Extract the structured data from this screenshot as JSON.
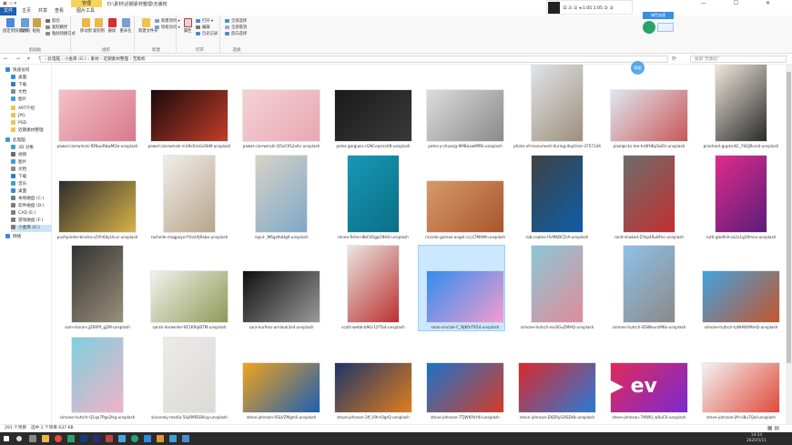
{
  "window": {
    "title": "D:\\素材\\近期素材整理\\无版权",
    "quick_access": "▣ ▭ ▾",
    "contextual_tab": "管理",
    "controls": "— ☐ ✕"
  },
  "ribbon_tabs": [
    "文件",
    "主页",
    "共享",
    "查看",
    "图片工具"
  ],
  "ribbon": {
    "groups": [
      {
        "label": "剪贴板",
        "buttons": [
          "固定到快速访问",
          "复制",
          "粘贴"
        ],
        "small": [
          "剪切",
          "复制路径",
          "粘贴快捷方式"
        ]
      },
      {
        "label": "组织",
        "buttons": [
          "移动到",
          "复制到",
          "删除",
          "重命名"
        ]
      },
      {
        "label": "新建",
        "buttons": [
          "新建文件夹"
        ],
        "small": [
          "新建项目 ▾",
          "轻松访问 ▾"
        ]
      },
      {
        "label": "打开",
        "buttons": [
          "属性"
        ],
        "small": [
          "打开 ▾",
          "编辑",
          "历史记录"
        ]
      },
      {
        "label": "选择",
        "small": [
          "全部选择",
          "全部取消",
          "反向选择"
        ]
      }
    ]
  },
  "overlay": {
    "text": "D  斗 斗 ◂ 1:05 1:05 斗 斗"
  },
  "widget": {
    "badge": "绿色加速"
  },
  "address": {
    "nav": "← → ▾ ↑",
    "path": "› 此电脑 › 小金库 (G:) › 素材 › 近期素材整理 › 无版权",
    "search_placeholder": "搜索\"无版权\""
  },
  "sidebar": {
    "items": [
      {
        "label": "快速访问",
        "icon": "star-icon",
        "color": "#3a87d6"
      },
      {
        "label": "桌面",
        "icon": "desktop-icon",
        "color": "#3b8ad6",
        "pinned": true
      },
      {
        "label": "下载",
        "icon": "download-icon",
        "color": "#2e7cd0",
        "pinned": true
      },
      {
        "label": "文档",
        "icon": "document-icon",
        "color": "#8a8a8a",
        "pinned": true
      },
      {
        "label": "图片",
        "icon": "picture-icon",
        "color": "#3aa0d8",
        "pinned": true
      },
      {
        "label": "ART介绍",
        "icon": "folder-icon",
        "color": "#f0c44c"
      },
      {
        "label": "JPG",
        "icon": "folder-icon",
        "color": "#f0c44c"
      },
      {
        "label": "PSD",
        "icon": "folder-icon",
        "color": "#f0c44c"
      },
      {
        "label": "近期素材整理",
        "icon": "folder-icon",
        "color": "#f0c44c"
      },
      {
        "label": "此电脑",
        "icon": "computer-icon",
        "color": "#4a90d9"
      },
      {
        "label": "3D 对象",
        "icon": "cube-icon",
        "color": "#3aa0d8"
      },
      {
        "label": "视频",
        "icon": "video-icon",
        "color": "#6a6a6a"
      },
      {
        "label": "图片",
        "icon": "picture-icon",
        "color": "#3aa0d8"
      },
      {
        "label": "文档",
        "icon": "document-icon",
        "color": "#8a8a8a"
      },
      {
        "label": "下载",
        "icon": "download-icon",
        "color": "#2e7cd0"
      },
      {
        "label": "音乐",
        "icon": "music-icon",
        "color": "#3aa0d8"
      },
      {
        "label": "桌面",
        "icon": "desktop-icon",
        "color": "#3b8ad6"
      },
      {
        "label": "本地磁盘 (C:)",
        "icon": "drive-icon",
        "color": "#7a7a7a"
      },
      {
        "label": "软件磁盘 (D:)",
        "icon": "drive-icon",
        "color": "#7a7a7a"
      },
      {
        "label": "CAD (E:)",
        "icon": "drive-icon",
        "color": "#7a7a7a"
      },
      {
        "label": "游戏磁盘 (F:)",
        "icon": "drive-icon",
        "color": "#7a7a7a"
      },
      {
        "label": "小金库 (G:)",
        "icon": "drive-icon",
        "color": "#7a7a7a",
        "selected": true
      },
      {
        "label": "网络",
        "icon": "network-icon",
        "color": "#3a87d6"
      }
    ]
  },
  "files": [
    {
      "name": "pawel-czerwinski-fDNuoRbwMOo-unsplash",
      "colors": [
        "#f3c1c8",
        "#d9798c"
      ],
      "orient": "land"
    },
    {
      "name": "pawel-czerwinski-m39e5mGsXbM-unsplash",
      "colors": [
        "#1b0b0b",
        "#c33d2a"
      ],
      "orient": "land"
    },
    {
      "name": "pawel-czerwinski-Q5oCtfL2xKc-unsplash",
      "colors": [
        "#f4d2d6",
        "#e9a7b2"
      ],
      "orient": "land"
    },
    {
      "name": "peter-gargiulo-cGNCepznaV8-unsplash",
      "colors": [
        "#1a1a1a",
        "#3a3a3a"
      ],
      "orient": "land"
    },
    {
      "name": "peter-y-chuang-9MBaxwMfRk-unsplash",
      "colors": [
        "#dcdcdc",
        "#8a8a8a"
      ],
      "orient": "land"
    },
    {
      "name": "photo-of-monument-during-daytime-3757144",
      "colors": [
        "#e0e4ea",
        "#9e8f7a"
      ],
      "orient": "port"
    },
    {
      "name": "pixelpicks-lee-hs0fHKpSxEU-unsplash",
      "colors": [
        "#dfe7f1",
        "#c95858"
      ],
      "orient": "land"
    },
    {
      "name": "prashant-gupta-KC_YSQJfkcn4-unsplash",
      "colors": [
        "#efe7dc",
        "#2a2a2a"
      ],
      "orient": "port"
    },
    {
      "name": "pushpinder-bindra-u5Yh6dyUcuc-unsplash",
      "colors": [
        "#2d2d2d",
        "#d8b24a"
      ],
      "orient": "land"
    },
    {
      "name": "rachelle-magpayo-YVvUAJ0abo-unsplash",
      "colors": [
        "#f0eeea",
        "#b8a48a"
      ],
      "orient": "port"
    },
    {
      "name": "rayul-_M6gz9oHgII-unsplash",
      "colors": [
        "#d8d2c5",
        "#7fa8c9"
      ],
      "orient": "port"
    },
    {
      "name": "renee-fisher-8bCkRgpCNHU-unsplash",
      "colors": [
        "#1798b5",
        "#0a6f85"
      ],
      "orient": "port"
    },
    {
      "name": "ricardo-gomez-angel-ccj-LTMAMI-unsplash",
      "colors": [
        "#d69a6b",
        "#a9552c"
      ],
      "orient": "land"
    },
    {
      "name": "rob-coates-l5rMKBCZrA-unsplash",
      "colors": [
        "#3e4243",
        "#0e5da7"
      ],
      "orient": "port"
    },
    {
      "name": "ronit-shaked-ZYkp4Ru8Fec-unsplash",
      "colors": [
        "#6d6d6d",
        "#c32f2f"
      ],
      "orient": "port"
    },
    {
      "name": "ruth-gledhill-za2x1g19mco-unsplash",
      "colors": [
        "#e02c8a",
        "#5a1c7a"
      ],
      "orient": "port"
    },
    {
      "name": "sam-moran-jjZ6RPt_gZM-unsplash",
      "colors": [
        "#333333",
        "#9a8f7a"
      ],
      "orient": "port"
    },
    {
      "name": "sarah-dorweiler-9Z1KRIpBTM-unsplash",
      "colors": [
        "#f2f2ee",
        "#8f9a56"
      ],
      "orient": "land"
    },
    {
      "name": "sara-kurfess-urnIauk3x4-unsplash",
      "colors": [
        "#101010",
        "#9a9a9a"
      ],
      "orient": "land"
    },
    {
      "name": "scott-webb-b9Gr1jYTb4-unsplash",
      "colors": [
        "#eae6e0",
        "#b93030"
      ],
      "orient": "port"
    },
    {
      "name": "sean-sinclair-C_NJKfnTR54-unsplash",
      "colors": [
        "#2f8ef0",
        "#f39cd0"
      ],
      "orient": "land",
      "selected": true
    },
    {
      "name": "simone-hutsch-eo3IGuZMHQ-unsplash",
      "colors": [
        "#8ac7d6",
        "#e08c9a"
      ],
      "orient": "port"
    },
    {
      "name": "simone-hutsch-lDSNeursM6o-unsplash",
      "colors": [
        "#8ec1e8",
        "#8a8a8a"
      ],
      "orient": "port"
    },
    {
      "name": "simone-hutsch-lyNHWXMmQ-unsplash",
      "colors": [
        "#3fa3de",
        "#c5552c"
      ],
      "orient": "land"
    },
    {
      "name": "simone-hutsch-Q1qo7Pgx2Hg-unsplash",
      "colors": [
        "#7ed0df",
        "#f0b2c6"
      ],
      "orient": "port"
    },
    {
      "name": "sincerely-media-5kjAMREBAcg-unsplash",
      "colors": [
        "#ecebe8",
        "#dcdad5"
      ],
      "orient": "port"
    },
    {
      "name": "steve-johnson-0SLVZMgmli-unsplash",
      "colors": [
        "#f0a31c",
        "#1c5fb4"
      ],
      "orient": "land"
    },
    {
      "name": "steve-johnson-3lf_U9nrOgrQ-unsplash",
      "colors": [
        "#1d3568",
        "#e07d1c"
      ],
      "orient": "land"
    },
    {
      "name": "steve-johnson-7TJWKPoYdI-unsplash",
      "colors": [
        "#1a74c8",
        "#d43c2a"
      ],
      "orient": "land"
    },
    {
      "name": "steve-johnson-EKDRyGOSDdk-unsplash",
      "colors": [
        "#d82a2a",
        "#2a7ad8"
      ],
      "orient": "land"
    },
    {
      "name": "steve-johnson-7WW0_w0uC0-unsplash",
      "colors": [
        "#e02a5a",
        "#7a2ad0"
      ],
      "orient": "land"
    },
    {
      "name": "steve-johnson-jM-ci8u7QaI-unsplash",
      "colors": [
        "#f2f2f2",
        "#e04a3a"
      ],
      "orient": "land"
    }
  ],
  "status": {
    "count": "291 个项目",
    "selection": "选中 1 个项目  637 KB"
  },
  "taskbar": {
    "time": "14:24",
    "date": "2020/5/11"
  },
  "floating_bubble": "帮助",
  "play_overlay": "▶ ev"
}
